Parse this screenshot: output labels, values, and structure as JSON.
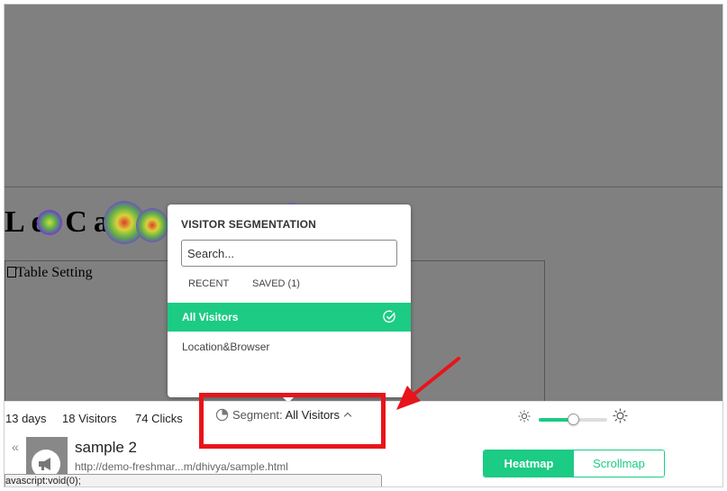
{
  "page": {
    "site_title": "Le Caterin",
    "image_alt": "Table Setting"
  },
  "segmentation_popup": {
    "title": "VISITOR SEGMENTATION",
    "search_placeholder": "Search...",
    "tabs": [
      {
        "label": "RECENT"
      },
      {
        "label": "SAVED (1)"
      }
    ],
    "items": [
      {
        "label": "All Visitors",
        "selected": true
      },
      {
        "label": "Location&Browser",
        "selected": false
      }
    ]
  },
  "stats_bar": {
    "days": "13 days",
    "visitors": "18 Visitors",
    "clicks": "74 Clicks",
    "segment_label": "Segment:",
    "segment_value": "All Visitors",
    "brightness_level": 0.5
  },
  "info_bar": {
    "page_name": "sample 2",
    "page_url": "http://demo-freshmar...m/dhivya/sample.html",
    "status_text": "avascript:void(0);",
    "modes": [
      {
        "label": "Heatmap",
        "active": true
      },
      {
        "label": "Scrollmap",
        "active": false
      }
    ]
  },
  "colors": {
    "accent": "#1ccb84",
    "annotation": "#e8141b",
    "overlay": "#808080"
  }
}
